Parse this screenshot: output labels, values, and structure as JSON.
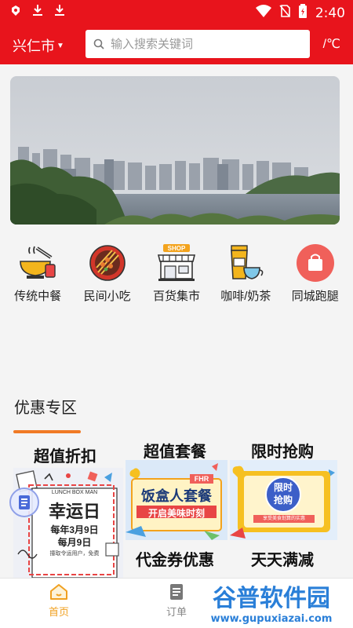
{
  "status_bar": {
    "time": "2:40"
  },
  "header": {
    "city": "兴仁市",
    "search_placeholder": "输入搜索关键词",
    "temperature": "/℃"
  },
  "categories": [
    {
      "label": "传统中餐",
      "icon": "rice-bowl-icon"
    },
    {
      "label": "民间小吃",
      "icon": "skewers-icon"
    },
    {
      "label": "百货集市",
      "icon": "shop-icon"
    },
    {
      "label": "咖啡/奶茶",
      "icon": "coffee-icon"
    },
    {
      "label": "同城跑腿",
      "icon": "delivery-bag-icon"
    }
  ],
  "section": {
    "title": "优惠专区"
  },
  "promos": {
    "discount": {
      "title": "超值折扣",
      "poster_brand": "LUNCH BOX MAN",
      "poster_headline": "幸运日",
      "poster_date_1": "每年3月9日",
      "poster_date_2": "每月9日",
      "poster_note": "撞取令运用户，免费"
    },
    "set_meal": {
      "title": "超值套餐",
      "badge": "FHR",
      "headline": "饭盒人套餐",
      "sub": "开启美味时刻"
    },
    "flash_sale": {
      "title": "限时抢购",
      "badge_line1": "限时",
      "badge_line2": "抢购",
      "sub": "享受美食划算的实惠"
    },
    "voucher": {
      "title": "代金券优惠"
    },
    "daily_off": {
      "title": "天天满减"
    }
  },
  "tabbar": {
    "home": "首页",
    "orders": "订单"
  },
  "watermark": {
    "name": "谷普软件园",
    "url": "www.gupuxiazai.com"
  },
  "colors": {
    "brand_red": "#e8141c",
    "accent_orange": "#f07a25",
    "tab_active": "#f0a020"
  }
}
